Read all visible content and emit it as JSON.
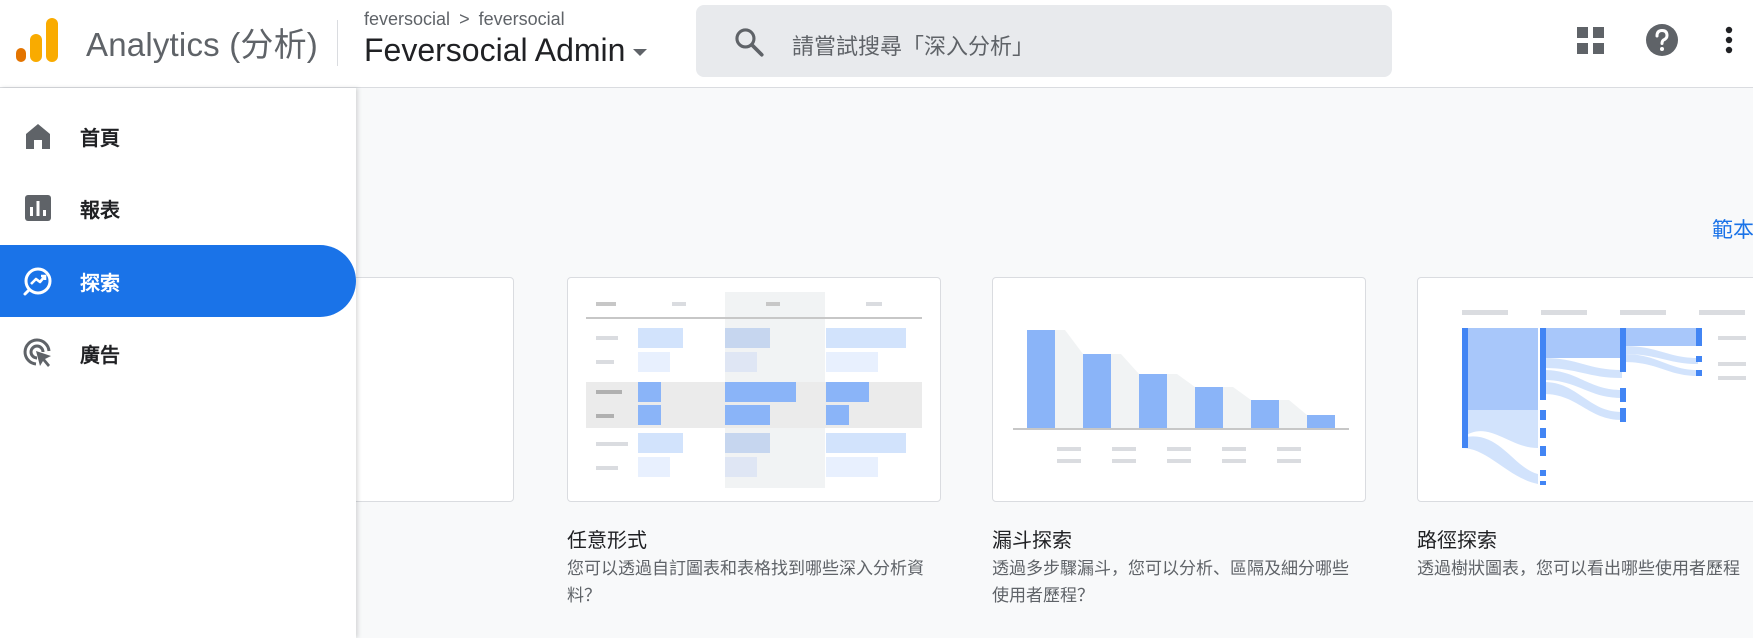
{
  "header": {
    "app_title": "Analytics (分析)",
    "breadcrumb_account": "feversocial",
    "breadcrumb_separator": ">",
    "breadcrumb_property": "feversocial",
    "property_name": "Feversocial Admin",
    "search_placeholder": "請嘗試搜尋「深入分析」",
    "icons": [
      "apps-grid-icon",
      "help-icon",
      "more-vert-icon"
    ]
  },
  "sidebar": {
    "items": [
      {
        "label": "首頁",
        "icon": "home-icon",
        "active": false
      },
      {
        "label": "報表",
        "icon": "bar-chart-icon",
        "active": false
      },
      {
        "label": "探索",
        "icon": "explore-icon",
        "active": true
      },
      {
        "label": "廣告",
        "icon": "advertising-icon",
        "active": false
      }
    ]
  },
  "main": {
    "templates_link": "範本",
    "cards": [
      {
        "title": "任意形式",
        "description": "您可以透過自訂圖表和表格找到哪些深入分析資料？"
      },
      {
        "title": "漏斗探索",
        "description": "透過多步驟漏斗，您可以分析、區隔及細分哪些使用者歷程？"
      },
      {
        "title": "路徑探索",
        "description": "透過樹狀圖表，您可以看出哪些使用者歷程"
      }
    ]
  },
  "colors": {
    "accent": "#1a73e8",
    "logo_orange": "#f9ab00",
    "logo_dark_orange": "#e37400",
    "chart_blue": "#8ab4f8",
    "chart_light_blue": "#d2e3fc"
  }
}
